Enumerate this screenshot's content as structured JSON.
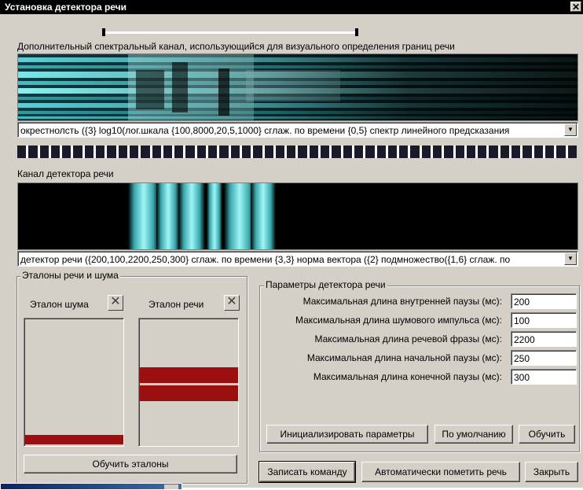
{
  "window": {
    "title": "Установка детектора речи",
    "close_glyph": "✕"
  },
  "spectral": {
    "label": "Дополнительный спектральный канал, использующийся для визуального определения границ речи",
    "combo_value": "окрестнолсть ({3} log10(лог.шкала {100,8000,20,5,1000} сглаж. по времени {0,5} спектр линейного предсказания"
  },
  "detector": {
    "label": "Канал детектора речи",
    "combo_value": "детектор речи ({200,100,2200,250,300} сглаж. по времени {3,3} норма вектора ({2} подмножество({1,6} сглаж. по"
  },
  "etalons": {
    "group_title": "Эталоны речи и шума",
    "noise_label": "Эталон шума",
    "speech_label": "Эталон речи",
    "clear_glyph": "✕",
    "train_button": "Обучить эталоны"
  },
  "params": {
    "group_title": "Параметры детектора речи",
    "fields": [
      {
        "label": "Максимальная длина внутренней паузы (мс):",
        "value": "200"
      },
      {
        "label": "Максимальная длина шумового импульса (мс):",
        "value": "100"
      },
      {
        "label": "Максимальная длина речевой фразы (мс):",
        "value": "2200"
      },
      {
        "label": "Максимальная длина начальной паузы (мс):",
        "value": "250"
      },
      {
        "label": "Максимальная длина конечной паузы (мс):",
        "value": "300"
      }
    ],
    "init_button": "Инициализировать параметры",
    "default_button": "По умолчанию",
    "train_button": "Обучить"
  },
  "footer": {
    "record_button": "Записать команду",
    "auto_button": "Автоматически пометить речь",
    "close_button": "Закрыть"
  },
  "colors": {
    "accent_cyan": "#6fe3e6",
    "etalon_bar": "#9c0f11",
    "title_bg": "#000000"
  }
}
